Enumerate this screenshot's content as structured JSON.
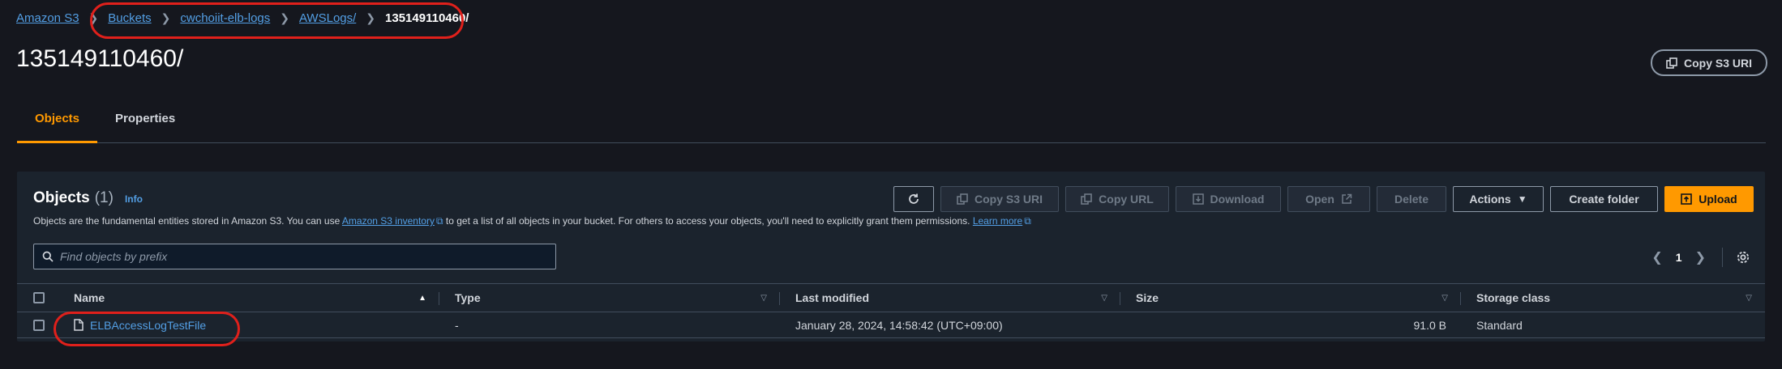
{
  "breadcrumb": {
    "root": "Amazon S3",
    "items": [
      "Buckets",
      "cwchoiit-elb-logs",
      "AWSLogs/"
    ],
    "current": "135149110460/"
  },
  "page": {
    "title": "135149110460/",
    "copy_uri_label": "Copy S3 URI"
  },
  "tabs": [
    {
      "label": "Objects",
      "active": true
    },
    {
      "label": "Properties",
      "active": false
    }
  ],
  "objects_panel": {
    "title": "Objects",
    "count": "(1)",
    "info": "Info",
    "description_prefix": "Objects are the fundamental entities stored in Amazon S3. You can use ",
    "inventory_link": "Amazon S3 inventory",
    "description_middle": " to get a list of all objects in your bucket. For others to access your objects, you'll need to explicitly grant them permissions. ",
    "learn_more": "Learn more",
    "toolbar": {
      "copy_s3_uri": "Copy S3 URI",
      "copy_url": "Copy URL",
      "download": "Download",
      "open": "Open",
      "delete": "Delete",
      "actions": "Actions",
      "create_folder": "Create folder",
      "upload": "Upload"
    },
    "search_placeholder": "Find objects by prefix",
    "pagination": {
      "page": "1"
    },
    "columns": {
      "name": "Name",
      "type": "Type",
      "last_modified": "Last modified",
      "size": "Size",
      "storage_class": "Storage class"
    },
    "rows": [
      {
        "name": "ELBAccessLogTestFile",
        "type": "-",
        "last_modified": "January 28, 2024, 14:58:42 (UTC+09:00)",
        "size": "91.0 B",
        "storage_class": "Standard"
      }
    ]
  },
  "colors": {
    "accent": "#ff9900",
    "link": "#539fe5",
    "highlight": "#e0201b",
    "background": "#15171e"
  }
}
